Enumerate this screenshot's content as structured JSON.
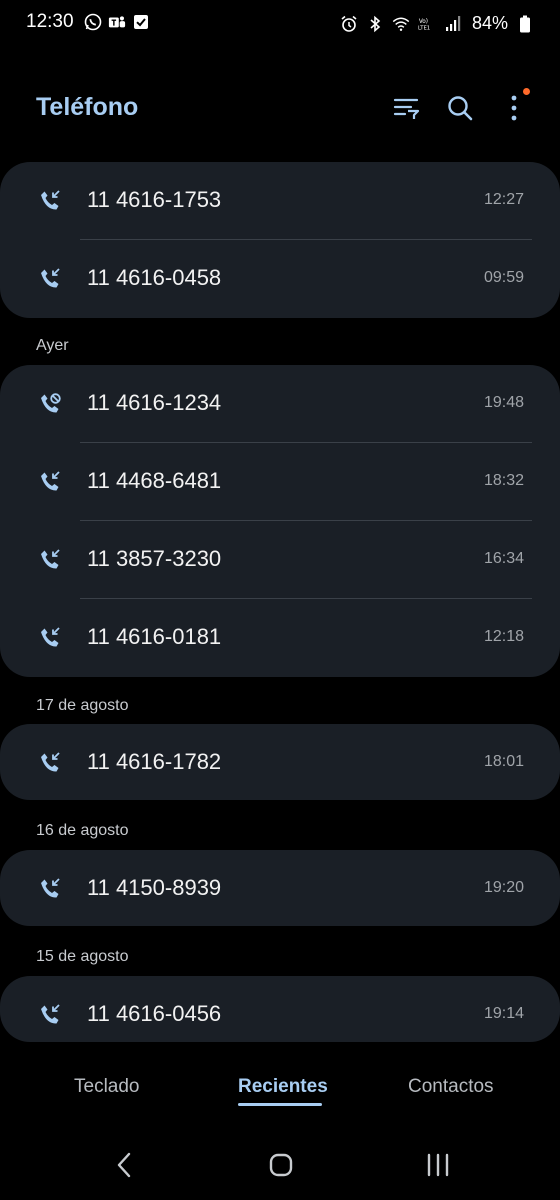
{
  "status_bar": {
    "time": "12:30",
    "battery": "84%"
  },
  "header": {
    "title": "Teléfono",
    "icons": [
      "filter-icon",
      "search-icon",
      "more-options-icon"
    ]
  },
  "groups": [
    {
      "label": "",
      "calls": [
        {
          "number": "11 4616-1753",
          "time": "12:27",
          "type": "incoming"
        },
        {
          "number": "11 4616-0458",
          "time": "09:59",
          "type": "incoming"
        }
      ]
    },
    {
      "label": "Ayer",
      "calls": [
        {
          "number": "11 4616-1234",
          "time": "19:48",
          "type": "rejected"
        },
        {
          "number": "11 4468-6481",
          "time": "18:32",
          "type": "incoming"
        },
        {
          "number": "11 3857-3230",
          "time": "16:34",
          "type": "incoming"
        },
        {
          "number": "11 4616-0181",
          "time": "12:18",
          "type": "incoming"
        }
      ]
    },
    {
      "label": "17 de agosto",
      "calls": [
        {
          "number": "11 4616-1782",
          "time": "18:01",
          "type": "incoming"
        }
      ]
    },
    {
      "label": "16 de agosto",
      "calls": [
        {
          "number": "11 4150-8939",
          "time": "19:20",
          "type": "incoming"
        }
      ]
    },
    {
      "label": "15 de agosto",
      "calls": [
        {
          "number": "11 4616-0456",
          "time": "19:14",
          "type": "incoming"
        }
      ]
    }
  ],
  "tabs": [
    {
      "label": "Teclado",
      "active": false
    },
    {
      "label": "Recientes",
      "active": true
    },
    {
      "label": "Contactos",
      "active": false
    }
  ],
  "colors": {
    "accent": "#a8cdf2",
    "card": "#1a1f26",
    "background": "#000000",
    "notification": "#ff6a2a"
  }
}
